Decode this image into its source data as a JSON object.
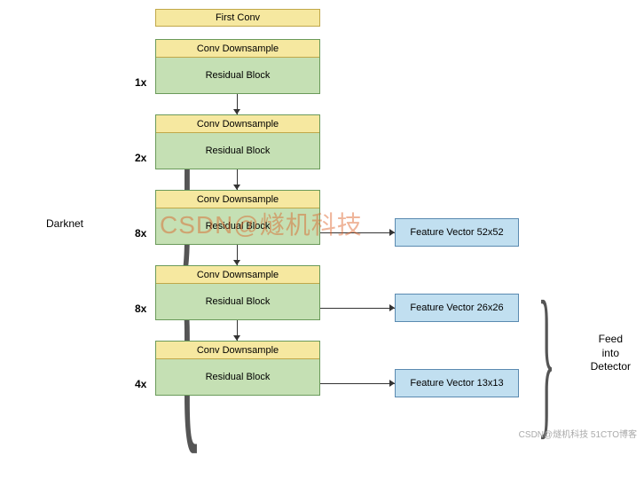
{
  "labels": {
    "darknet": "Darknet",
    "detector": "Feed\ninto\nDetector"
  },
  "first_conv": "First Conv",
  "stages": [
    {
      "mult": "1x",
      "conv": "Conv Downsample",
      "res": "Residual Block"
    },
    {
      "mult": "2x",
      "conv": "Conv Downsample",
      "res": "Residual Block"
    },
    {
      "mult": "8x",
      "conv": "Conv Downsample",
      "res": "Residual Block"
    },
    {
      "mult": "8x",
      "conv": "Conv Downsample",
      "res": "Residual Block"
    },
    {
      "mult": "4x",
      "conv": "Conv Downsample",
      "res": "Residual Block"
    }
  ],
  "feature_vectors": [
    "Feature Vector 52x52",
    "Feature Vector 26x26",
    "Feature Vector 13x13"
  ],
  "watermark": "CSDN@燧机科技",
  "footer": "CSDN@燧机科技 51CTO博客"
}
